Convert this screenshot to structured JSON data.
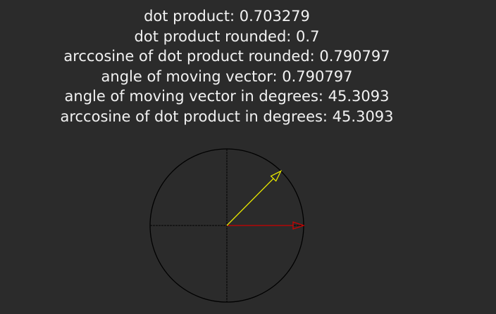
{
  "readout": {
    "dot_product": "dot product: 0.703279",
    "dot_product_rounded": "dot product rounded: 0.7",
    "arccos_rounded": "arccosine of dot product rounded: 0.790797",
    "angle_moving": "angle of moving vector: 0.790797",
    "angle_moving_deg": "angle of moving vector in degrees: 45.3093",
    "arccos_deg": "arccosine of dot product in degrees: 45.3093"
  },
  "vectors": {
    "fixed_angle_deg": 0,
    "moving_angle_deg": 45.3093
  },
  "colors": {
    "background": "#2b2b2b",
    "text": "#f2f2f2",
    "circle": "#000000",
    "fixed_vector": "#cc0000",
    "moving_vector": "#e6e600"
  }
}
